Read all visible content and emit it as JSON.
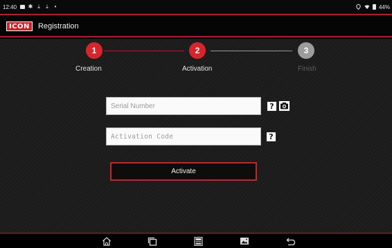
{
  "status_bar": {
    "time": "12:40",
    "battery_percent": "44%",
    "icons": [
      "message-icon",
      "settings-icon",
      "download-icon",
      "download-icon",
      "dot-icon"
    ],
    "right_icons": [
      "location-icon",
      "wifi-icon",
      "battery-icon"
    ]
  },
  "header": {
    "logo": "ICON",
    "title": "Registration"
  },
  "stepper": {
    "steps": [
      {
        "number": "1",
        "label": "Creation",
        "state": "done"
      },
      {
        "number": "2",
        "label": "Activation",
        "state": "active"
      },
      {
        "number": "3",
        "label": "Finish",
        "state": "pending"
      }
    ]
  },
  "form": {
    "serial_placeholder": "Serial Number",
    "serial_value": "",
    "activation_placeholder": "Activation Code",
    "activation_value": "",
    "help_label": "?",
    "activate_label": "Activate"
  },
  "nav_bar": {
    "buttons": [
      "home-icon",
      "recent-apps-icon",
      "vci-icon",
      "gallery-icon",
      "back-icon"
    ]
  },
  "colors": {
    "accent": "#d21f26",
    "pending": "#9c9c9c",
    "background": "#1b1b1b"
  }
}
